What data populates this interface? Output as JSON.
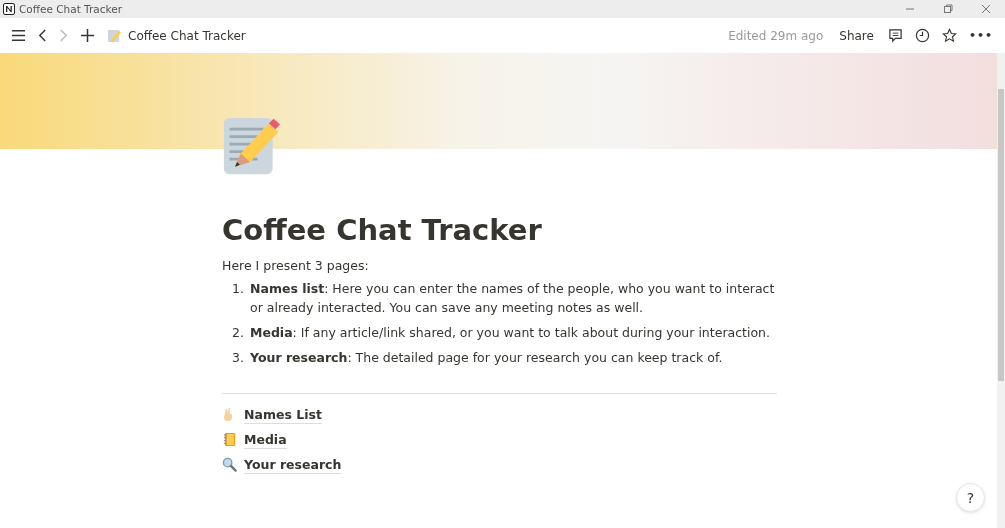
{
  "window": {
    "title": "Coffee Chat Tracker"
  },
  "topbar": {
    "breadcrumb": "Coffee Chat Tracker",
    "edited": "Edited 29m ago",
    "share": "Share",
    "more": "•••"
  },
  "page": {
    "title": "Coffee Chat Tracker",
    "intro": "Here I present 3 pages:",
    "items": [
      {
        "number": "1.",
        "text": "**Names list**: Here you can enter the names of the people, who you want to interact or already interacted. You can save any meeting notes as well."
      },
      {
        "number": "2.",
        "text": "**Media**: If any article/link shared, or you want to talk about during your interaction."
      },
      {
        "number": "3.",
        "text": "**Your research**: The detailed page for your research you can keep track of."
      }
    ],
    "links": [
      {
        "kind": "hand",
        "label": "Names List"
      },
      {
        "kind": "notebook",
        "label": "Media"
      },
      {
        "kind": "magnifier",
        "label": "Your research"
      }
    ]
  },
  "help": "?"
}
